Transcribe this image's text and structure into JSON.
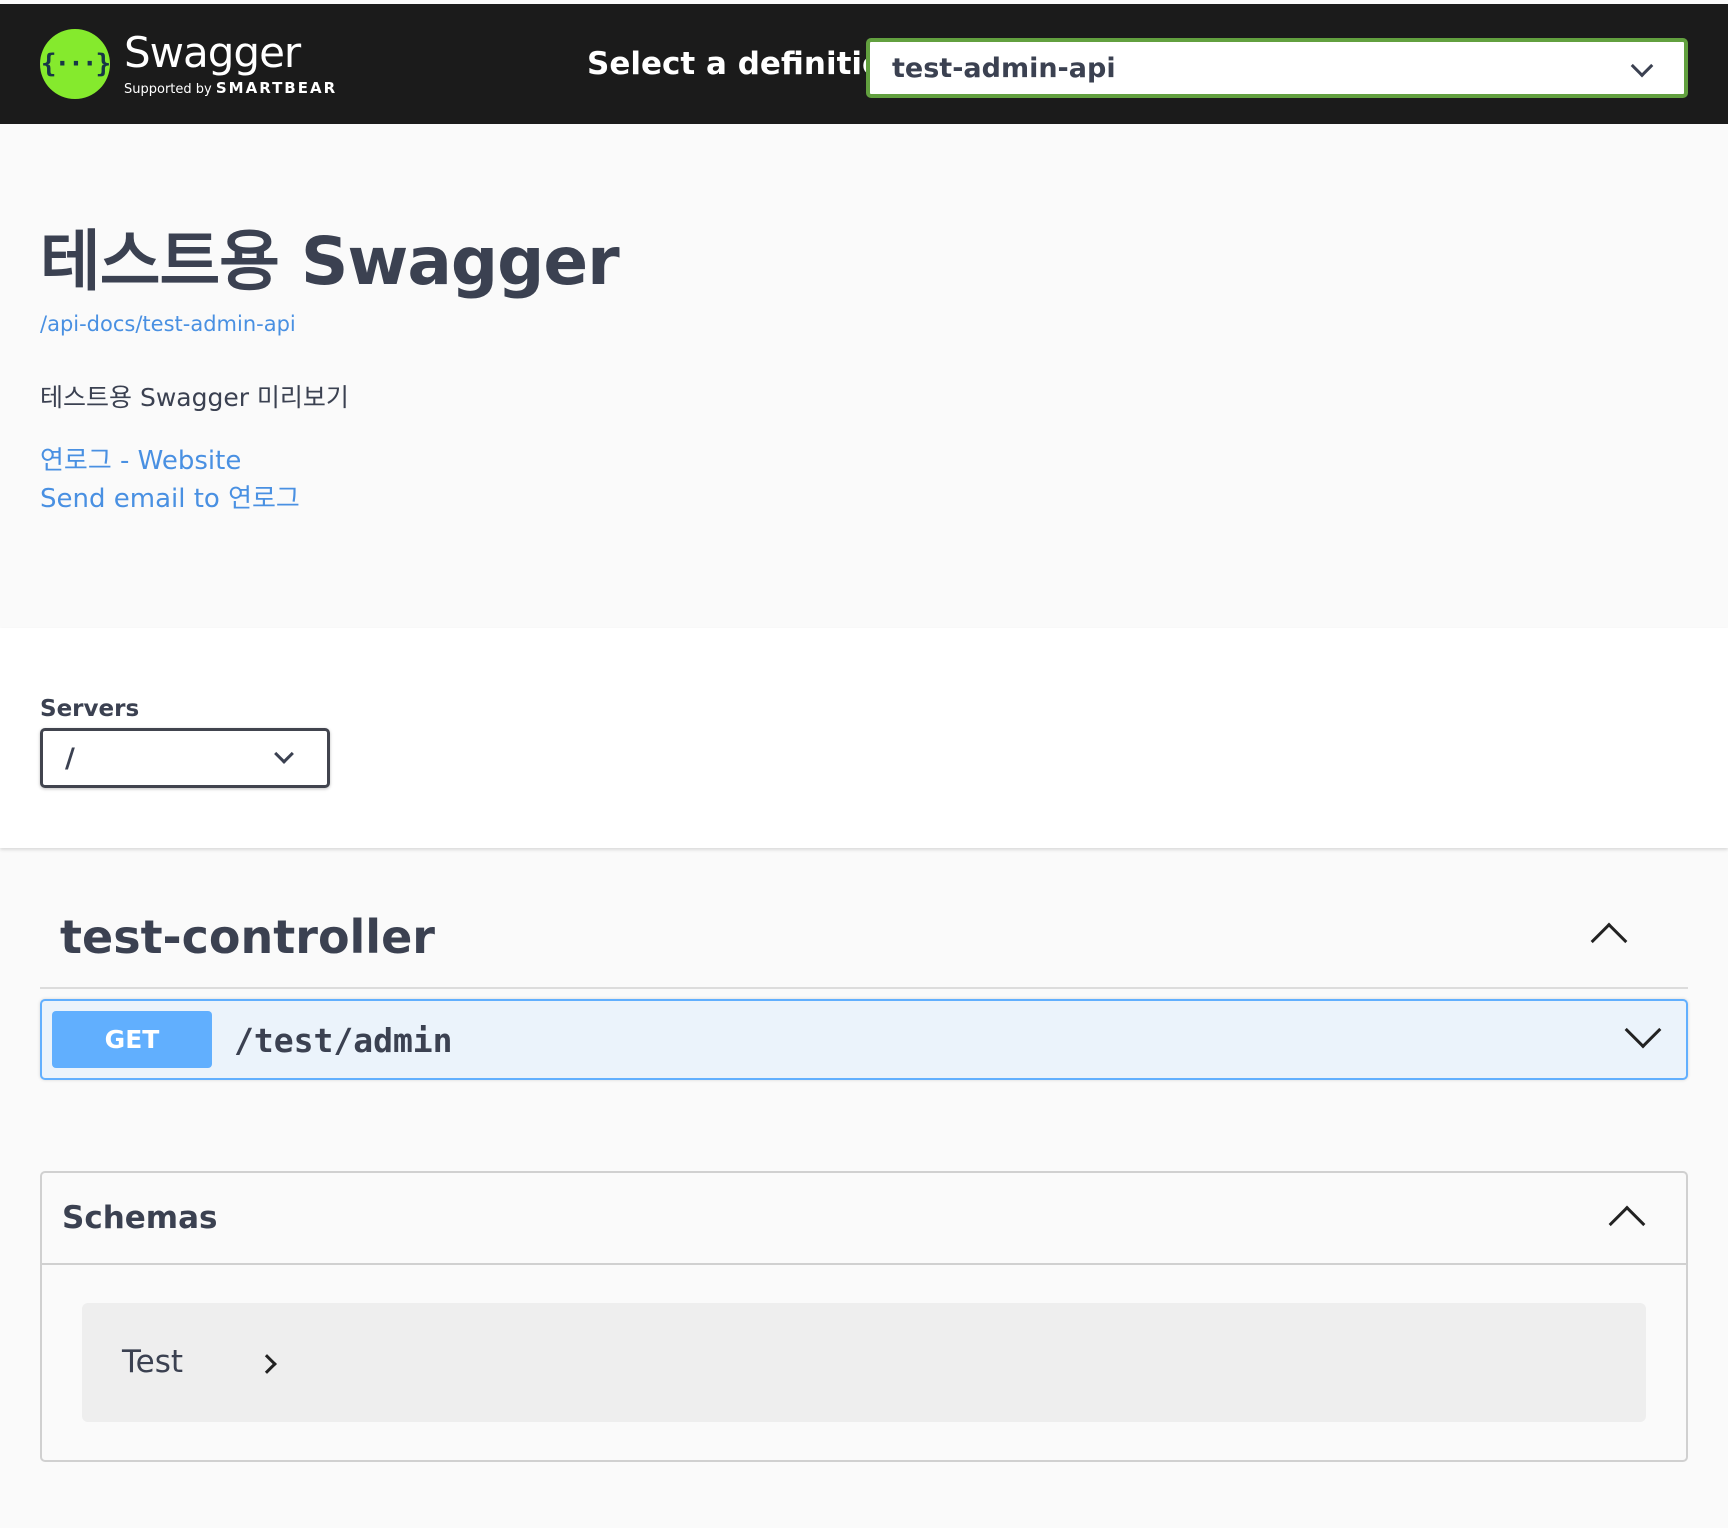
{
  "topbar": {
    "logo_name": "Swagger",
    "logo_supported_by": "Supported by",
    "logo_brand": "SMARTBEAR",
    "logo_icon_glyph": "{···}",
    "definition_label": "Select a definition",
    "definition_selected": "test-admin-api"
  },
  "info": {
    "title": "테스트용 Swagger",
    "spec_url": "/api-docs/test-admin-api",
    "description": "테스트용 Swagger 미리보기",
    "contact_website": "연로그 - Website",
    "contact_email": "Send email to 연로그"
  },
  "servers": {
    "label": "Servers",
    "selected": "/"
  },
  "tags": [
    {
      "name": "test-controller",
      "operations": [
        {
          "method": "GET",
          "path": "/test/admin"
        }
      ]
    }
  ],
  "schemas": {
    "title": "Schemas",
    "models": [
      "Test"
    ]
  },
  "colors": {
    "topbar_bg": "#1b1b1b",
    "logo_green": "#85ea2d",
    "select_border": "#62a03f",
    "link": "#4990e2",
    "get_method": "#61affe",
    "get_bg": "#ebf3fb"
  }
}
